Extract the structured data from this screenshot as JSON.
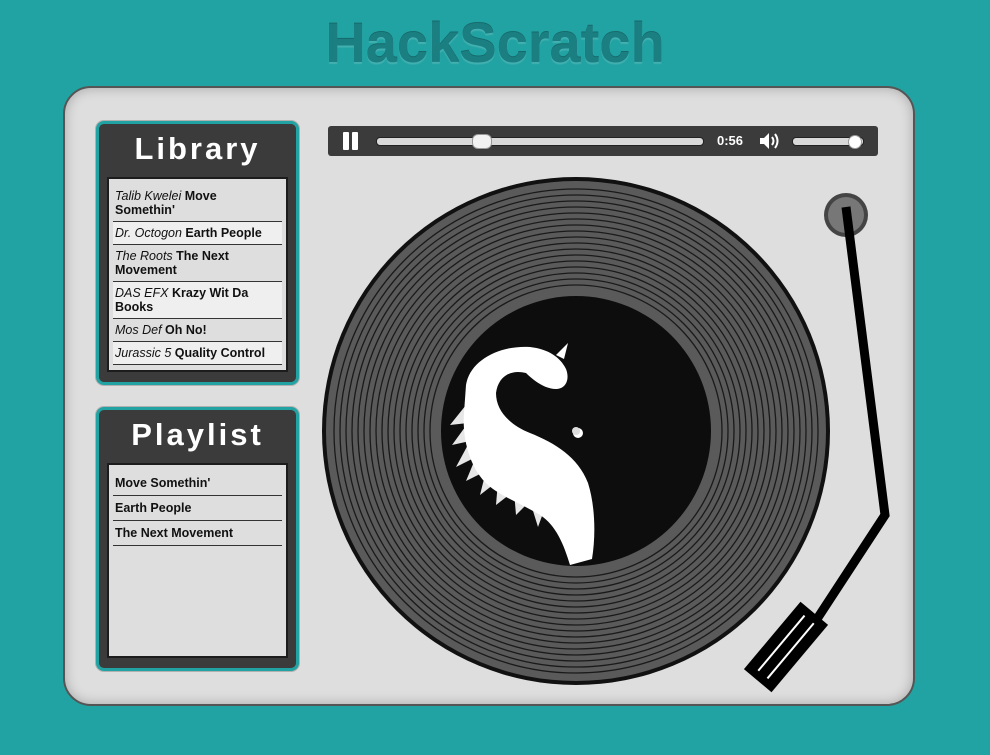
{
  "app": {
    "title": "HackScratch"
  },
  "library": {
    "title": "Library",
    "tracks": [
      {
        "artist": "Talib Kwelei",
        "song": "Move Somethin'"
      },
      {
        "artist": "Dr. Octogon",
        "song": "Earth People"
      },
      {
        "artist": "The Roots",
        "song": "The Next Movement"
      },
      {
        "artist": "DAS EFX",
        "song": "Krazy Wit Da Books"
      },
      {
        "artist": "Mos Def",
        "song": "Oh No!"
      },
      {
        "artist": "Jurassic 5",
        "song": "Quality Control"
      }
    ]
  },
  "playlist": {
    "title": "Playlist",
    "items": [
      {
        "song": "Move Somethin'"
      },
      {
        "song": "Earth People"
      },
      {
        "song": "The Next Movement"
      }
    ]
  },
  "player": {
    "state": "playing",
    "time": "0:56",
    "progress_fraction": 0.31,
    "volume_fraction": 0.95
  },
  "colors": {
    "background": "#22a3a3",
    "title_text": "#1b7f82",
    "deck": "#dedede",
    "panel": "#3b3b3b",
    "record": "#5a5a5a",
    "label": "#0d0d0d"
  },
  "icons": {
    "pause": "pause-icon",
    "volume": "speaker-volume-icon"
  }
}
